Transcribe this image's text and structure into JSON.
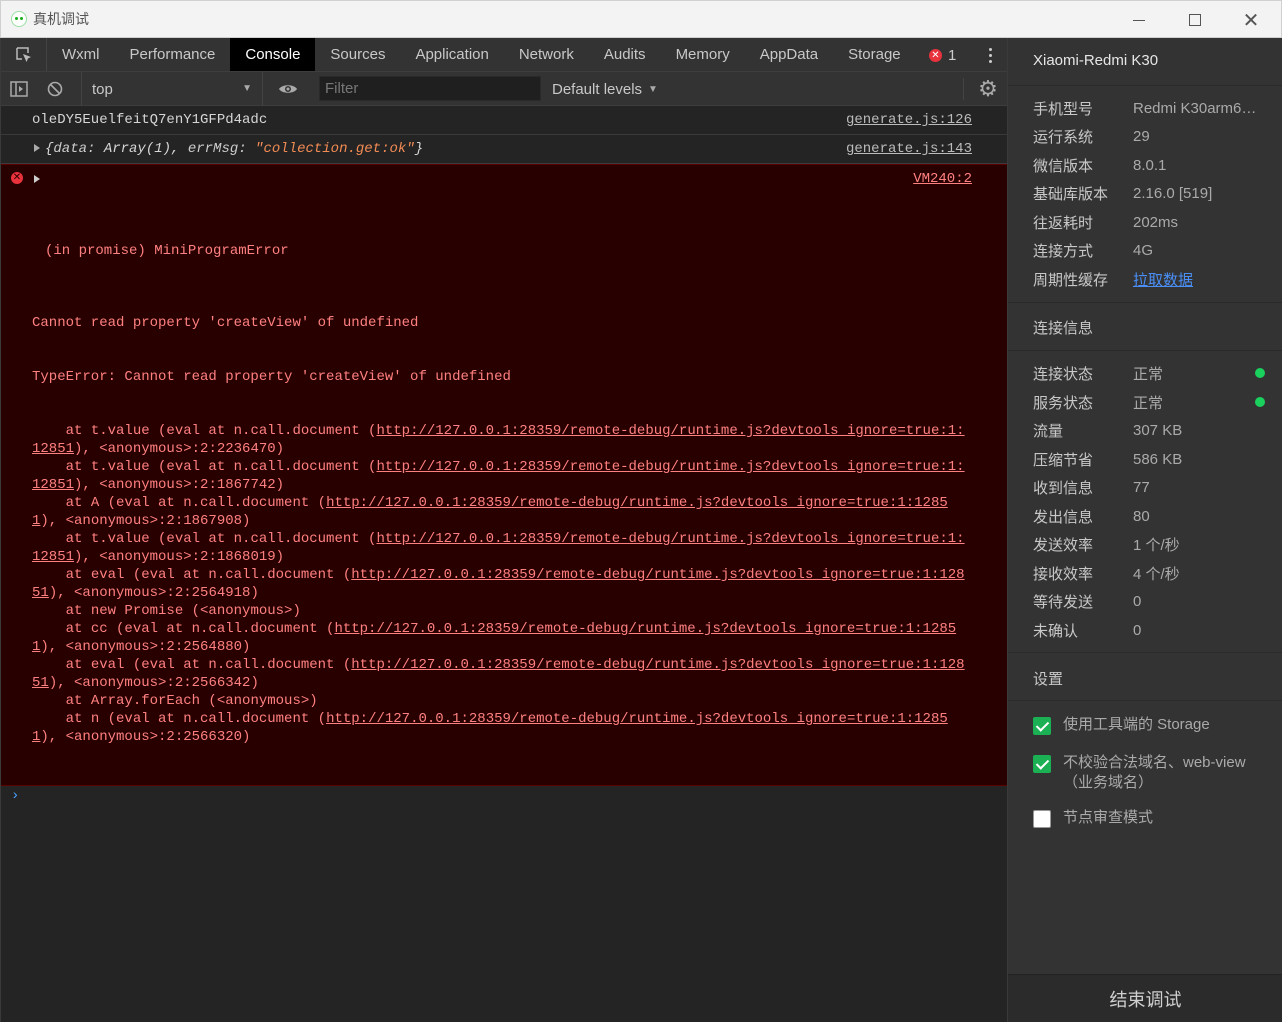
{
  "window": {
    "title": "真机调试"
  },
  "tabs": [
    {
      "label": "Wxml",
      "active": false
    },
    {
      "label": "Performance",
      "active": false
    },
    {
      "label": "Console",
      "active": true
    },
    {
      "label": "Sources",
      "active": false
    },
    {
      "label": "Application",
      "active": false
    },
    {
      "label": "Network",
      "active": false
    },
    {
      "label": "Audits",
      "active": false
    },
    {
      "label": "Memory",
      "active": false
    },
    {
      "label": "AppData",
      "active": false
    },
    {
      "label": "Storage",
      "active": false
    }
  ],
  "error_badge": {
    "count": "1"
  },
  "toolbar": {
    "context": "top",
    "filter_placeholder": "Filter",
    "levels": "Default levels"
  },
  "console": {
    "log1": {
      "text": "oleDY5EuelfeitQ7enY1GFPd4adc",
      "source": "generate.js:126"
    },
    "log2": {
      "open": "{",
      "k1": "data:",
      "v1": " Array(1), ",
      "k2": "errMsg:",
      "v2": " \"collection.get:ok\"",
      "close": "}",
      "source": "generate.js:143"
    },
    "error": {
      "head": "(in promise) MiniProgramError",
      "source": "VM240:2",
      "message": "Cannot read property 'createView' of undefined",
      "type_line": "TypeError: Cannot read property 'createView' of undefined",
      "stack": [
        {
          "pre": "    at t.value (eval at n.call.document (",
          "url": "http://127.0.0.1:28359/remote-debug/runtime.js?devtools_ignore=true:1:12851",
          "post": "), <anonymous>:2:2236470)"
        },
        {
          "pre": "    at t.value (eval at n.call.document (",
          "url": "http://127.0.0.1:28359/remote-debug/runtime.js?devtools_ignore=true:1:12851",
          "post": "), <anonymous>:2:1867742)"
        },
        {
          "pre": "    at A (eval at n.call.document (",
          "url": "http://127.0.0.1:28359/remote-debug/runtime.js?devtools_ignore=true:1:12851",
          "post": "), <anonymous>:2:1867908)"
        },
        {
          "pre": "    at t.value (eval at n.call.document (",
          "url": "http://127.0.0.1:28359/remote-debug/runtime.js?devtools_ignore=true:1:12851",
          "post": "), <anonymous>:2:1868019)"
        },
        {
          "pre": "    at eval (eval at n.call.document (",
          "url": "http://127.0.0.1:28359/remote-debug/runtime.js?devtools_ignore=true:1:12851",
          "post": "), <anonymous>:2:2564918)"
        },
        {
          "pre": "    at new Promise (<anonymous>)",
          "url": "",
          "post": ""
        },
        {
          "pre": "    at cc (eval at n.call.document (",
          "url": "http://127.0.0.1:28359/remote-debug/runtime.js?devtools_ignore=true:1:12851",
          "post": "), <anonymous>:2:2564880)"
        },
        {
          "pre": "    at eval (eval at n.call.document (",
          "url": "http://127.0.0.1:28359/remote-debug/runtime.js?devtools_ignore=true:1:12851",
          "post": "), <anonymous>:2:2566342)"
        },
        {
          "pre": "    at Array.forEach (<anonymous>)",
          "url": "",
          "post": ""
        },
        {
          "pre": "    at n (eval at n.call.document (",
          "url": "http://127.0.0.1:28359/remote-debug/runtime.js?devtools_ignore=true:1:12851",
          "post": "), <anonymous>:2:2566320)"
        }
      ]
    },
    "prompt": "›"
  },
  "device": {
    "name": "Xiaomi-Redmi K30",
    "info": [
      {
        "label": "手机型号",
        "value": "Redmi K30arm64..."
      },
      {
        "label": "运行系统",
        "value": "29"
      },
      {
        "label": "微信版本",
        "value": "8.0.1"
      },
      {
        "label": "基础库版本",
        "value": "2.16.0 [519]"
      },
      {
        "label": "往返耗时",
        "value": "202ms"
      },
      {
        "label": "连接方式",
        "value": "4G"
      },
      {
        "label": "周期性缓存",
        "value": "拉取数据"
      }
    ]
  },
  "connection": {
    "title": "连接信息",
    "rows": [
      {
        "label": "连接状态",
        "value": "正常"
      },
      {
        "label": "服务状态",
        "value": "正常"
      },
      {
        "label": "流量",
        "value": "307 KB"
      },
      {
        "label": "压缩节省",
        "value": "586 KB"
      },
      {
        "label": "收到信息",
        "value": "77"
      },
      {
        "label": "发出信息",
        "value": "80"
      },
      {
        "label": "发送效率",
        "value": "1 个/秒"
      },
      {
        "label": "接收效率",
        "value": "4 个/秒"
      },
      {
        "label": "等待发送",
        "value": "0"
      },
      {
        "label": "未确认",
        "value": "0"
      }
    ],
    "status_color": "#1ad15e"
  },
  "settings": {
    "title": "设置",
    "options": [
      {
        "label": "使用工具端的 Storage",
        "checked": true
      },
      {
        "label": "不校验合法域名、web-view（业务域名）",
        "checked": true
      },
      {
        "label": "节点审查模式",
        "checked": false
      }
    ]
  },
  "end_button": "结束调试",
  "colors": {
    "accent_green": "#1ab053",
    "error_red": "#e8323c",
    "error_bg": "#290000",
    "link_blue": "#4a8ff7"
  }
}
